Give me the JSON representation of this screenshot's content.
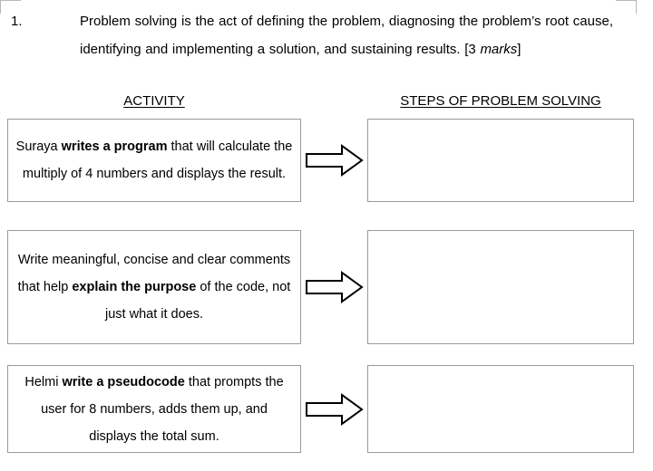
{
  "page": {
    "question_number": "1.",
    "question_text_before_marks": "Problem solving is the act of defining the problem, diagnosing the problem’s root cause, identifying and implementing a solution, and sustaining results. [3 ",
    "marks_italic": "marks",
    "question_text_after_marks": "]"
  },
  "headers": {
    "activity": "ACTIVITY",
    "steps": "STEPS OF PROBLEM SOLVING"
  },
  "rows": [
    {
      "activity_plain_1": "Suraya ",
      "activity_bold": "writes a program",
      "activity_plain_2": " that will calculate the multiply of 4 numbers and displays the result.",
      "answer": ""
    },
    {
      "activity_plain_1": "Write meaningful, concise and clear comments that help ",
      "activity_bold": "explain the purpose",
      "activity_plain_2": " of the code, not just what it does.",
      "answer": ""
    },
    {
      "activity_plain_1": "Helmi ",
      "activity_bold": "write a pseudocode",
      "activity_plain_2": " that prompts the user for 8 numbers, adds them up, and displays the total sum.",
      "answer": ""
    }
  ],
  "colors": {
    "text": "#000000",
    "box_border": "#9a9a9a",
    "arrow_stroke": "#000000",
    "arrow_fill": "#ffffff",
    "page_background": "#ffffff",
    "margin_marker": "#b9b9b9"
  },
  "icons": {
    "arrow": "right-block-arrow-icon",
    "corner_marker": "page-margin-corner-icon"
  }
}
